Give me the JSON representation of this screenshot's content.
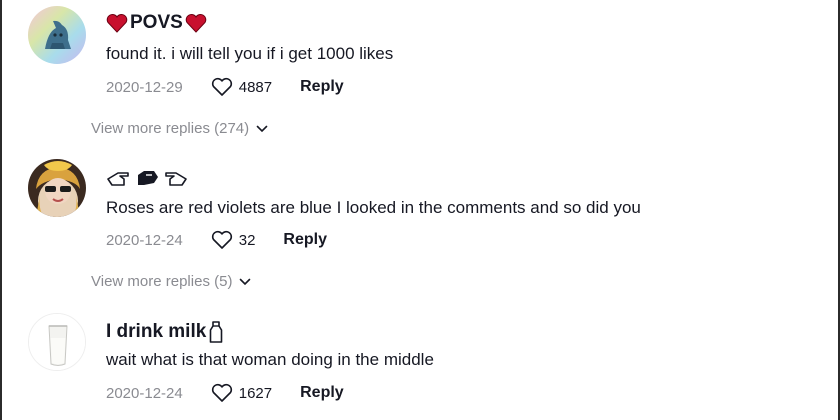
{
  "comments": [
    {
      "username": "POVS",
      "text": "found it. i will tell you if i get 1000 likes",
      "date": "2020-12-29",
      "likes": "4887",
      "reply_label": "Reply"
    },
    {
      "username": "",
      "text": "Roses are red violets are blue I looked in the comments and so did you",
      "date": "2020-12-24",
      "likes": "32",
      "reply_label": "Reply"
    },
    {
      "username": "I drink milk",
      "text": "wait what is that woman doing in the middle",
      "date": "2020-12-24",
      "likes": "1627",
      "reply_label": "Reply"
    }
  ],
  "view_more": [
    {
      "label": "View more replies (274)"
    },
    {
      "label": "View more replies (5)"
    }
  ],
  "icons": {
    "like": "heart-outline-icon",
    "expand": "chevron-down-icon",
    "name_decor_1": "red-heart-icon",
    "name_decor_2": "pointing-hand-icon",
    "name_decor_3": "milk-bottle-icon"
  },
  "colors": {
    "text": "#161823",
    "muted": "#8a8b91",
    "heart": "#c8102e"
  }
}
